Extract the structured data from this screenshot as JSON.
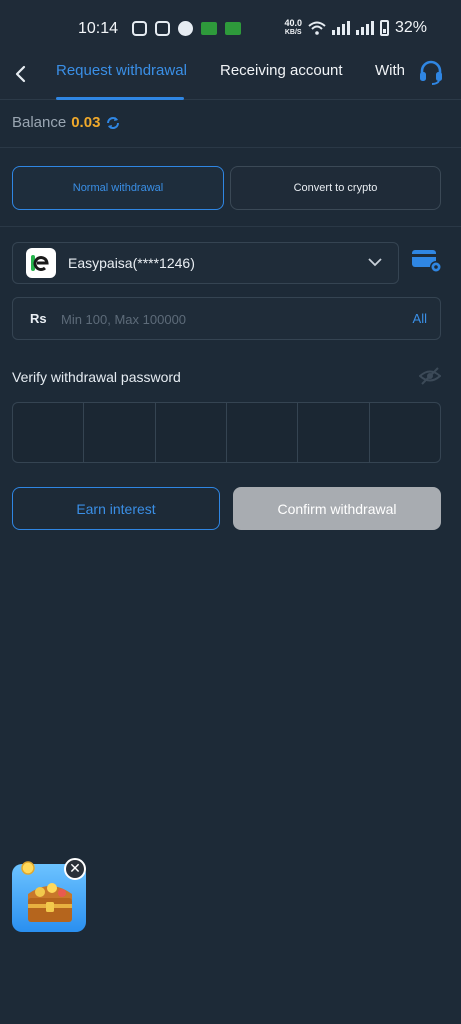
{
  "status_bar": {
    "time": "10:14",
    "net_speed_value": "40.0",
    "net_speed_unit": "KB/S",
    "battery": "32%"
  },
  "tabs": [
    {
      "label": "Request withdrawal",
      "active": true
    },
    {
      "label": "Receiving account",
      "active": false
    },
    {
      "label": "With",
      "active": false
    }
  ],
  "balance": {
    "label": "Balance",
    "value": "0.03"
  },
  "withdraw_types": {
    "normal": "Normal withdrawal",
    "crypto": "Convert to crypto"
  },
  "account": {
    "name": "Easypaisa(****1246)"
  },
  "amount": {
    "currency": "Rs",
    "placeholder": "Min 100, Max 100000",
    "all_label": "All"
  },
  "password": {
    "label": "Verify withdrawal password",
    "cells": 6
  },
  "buttons": {
    "earn_interest": "Earn interest",
    "confirm_withdrawal": "Confirm withdrawal"
  },
  "colors": {
    "background": "#1d2a37",
    "accent": "#2f86e3",
    "balance": "#f0a92b",
    "confirm_disabled": "#a8acb1"
  }
}
